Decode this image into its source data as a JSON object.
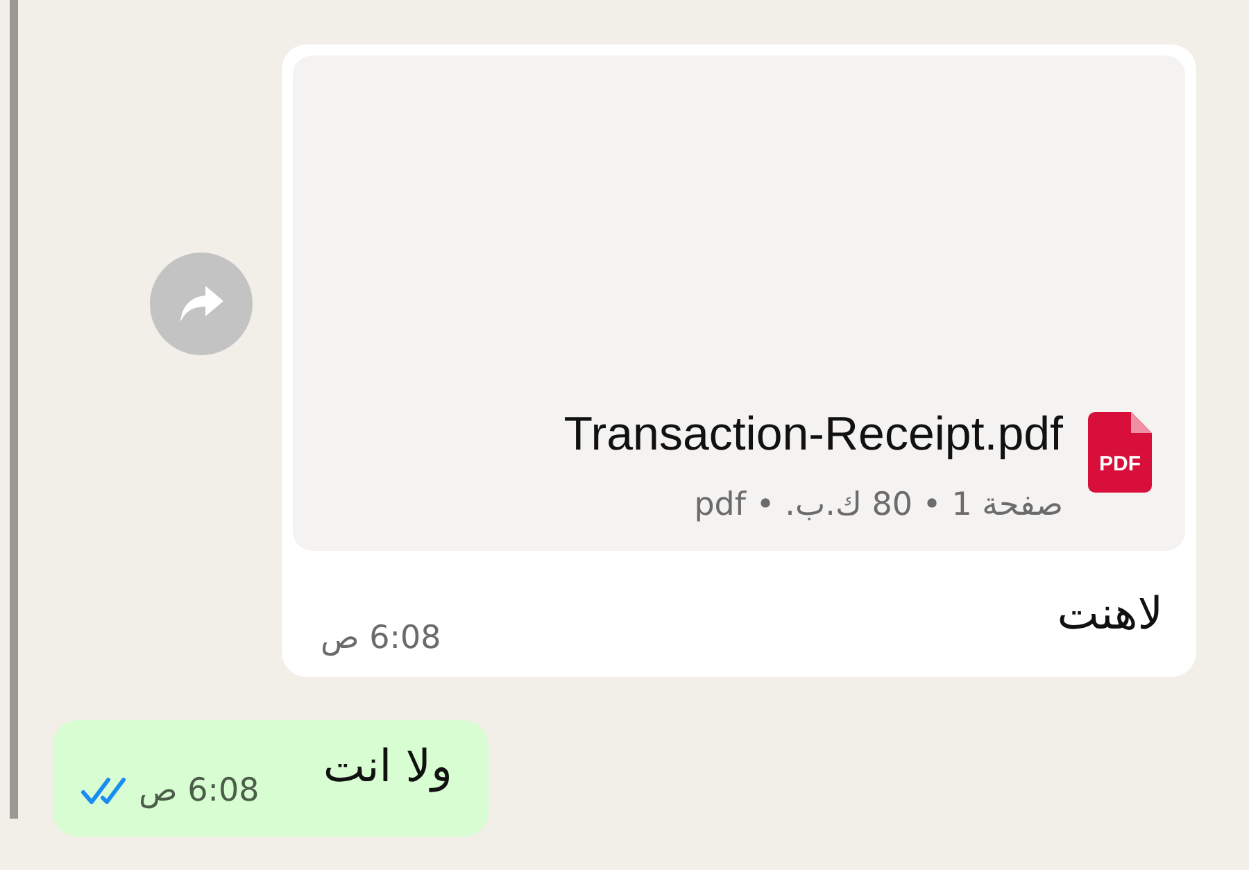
{
  "messages": [
    {
      "kind": "document",
      "outgoing": false,
      "document": {
        "icon_label": "PDF",
        "file_name": "Transaction-Receipt.pdf",
        "meta": "صفحة 1 • 80 ك.ب. • pdf"
      },
      "text": "لاهنت",
      "time": "6:08 ص"
    },
    {
      "kind": "text",
      "outgoing": true,
      "text": "ولا انت",
      "time": "6:08 ص",
      "read": true
    }
  ]
}
